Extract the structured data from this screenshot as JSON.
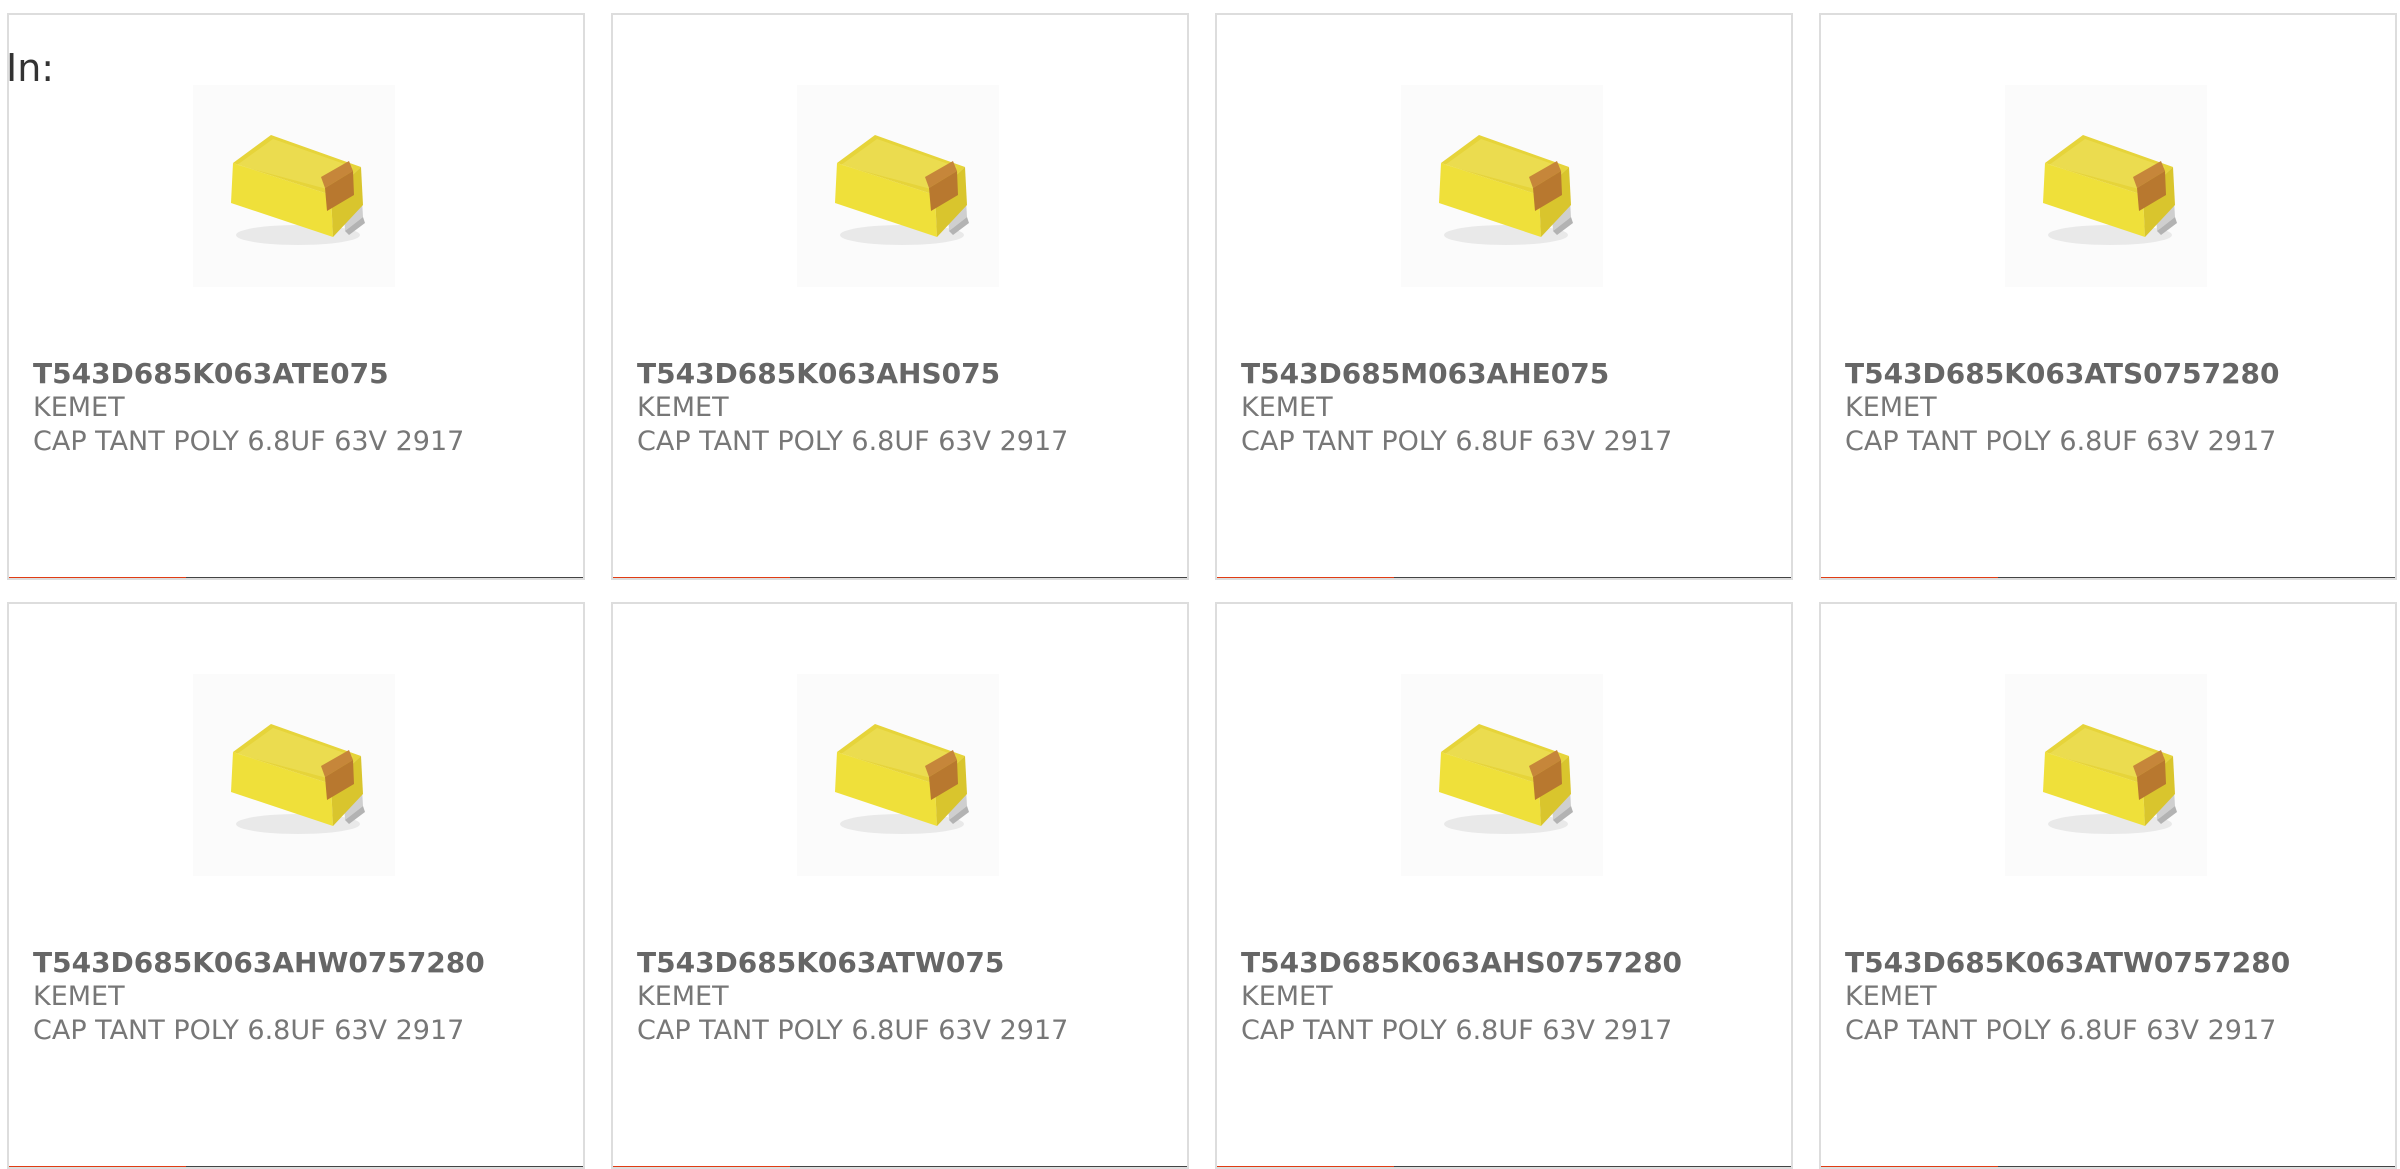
{
  "header": {
    "in_label": "In:"
  },
  "colors": {
    "accent": "#e03c14",
    "bar_track": "#444444",
    "card_border": "#dddddd",
    "title_text": "#666666",
    "body_text": "#777777"
  },
  "products": [
    {
      "part_number": "T543D685K063ATE075",
      "manufacturer": "KEMET",
      "description": "CAP TANT POLY 6.8UF 63V 2917",
      "image_icon": "tantalum-capacitor-icon",
      "bar_fill_fraction": 0.31
    },
    {
      "part_number": "T543D685K063AHS075",
      "manufacturer": "KEMET",
      "description": "CAP TANT POLY 6.8UF 63V 2917",
      "image_icon": "tantalum-capacitor-icon",
      "bar_fill_fraction": 0.31
    },
    {
      "part_number": "T543D685M063AHE075",
      "manufacturer": "KEMET",
      "description": "CAP TANT POLY 6.8UF 63V 2917",
      "image_icon": "tantalum-capacitor-icon",
      "bar_fill_fraction": 0.31
    },
    {
      "part_number": "T543D685K063ATS0757280",
      "manufacturer": "KEMET",
      "description": "CAP TANT POLY 6.8UF 63V 2917",
      "image_icon": "tantalum-capacitor-icon",
      "bar_fill_fraction": 0.31
    },
    {
      "part_number": "T543D685K063AHW0757280",
      "manufacturer": "KEMET",
      "description": "CAP TANT POLY 6.8UF 63V 2917",
      "image_icon": "tantalum-capacitor-icon",
      "bar_fill_fraction": 0.31
    },
    {
      "part_number": "T543D685K063ATW075",
      "manufacturer": "KEMET",
      "description": "CAP TANT POLY 6.8UF 63V 2917",
      "image_icon": "tantalum-capacitor-icon",
      "bar_fill_fraction": 0.31
    },
    {
      "part_number": "T543D685K063AHS0757280",
      "manufacturer": "KEMET",
      "description": "CAP TANT POLY 6.8UF 63V 2917",
      "image_icon": "tantalum-capacitor-icon",
      "bar_fill_fraction": 0.31
    },
    {
      "part_number": "T543D685K063ATW0757280",
      "manufacturer": "KEMET",
      "description": "CAP TANT POLY 6.8UF 63V 2917",
      "image_icon": "tantalum-capacitor-icon",
      "bar_fill_fraction": 0.31
    }
  ]
}
